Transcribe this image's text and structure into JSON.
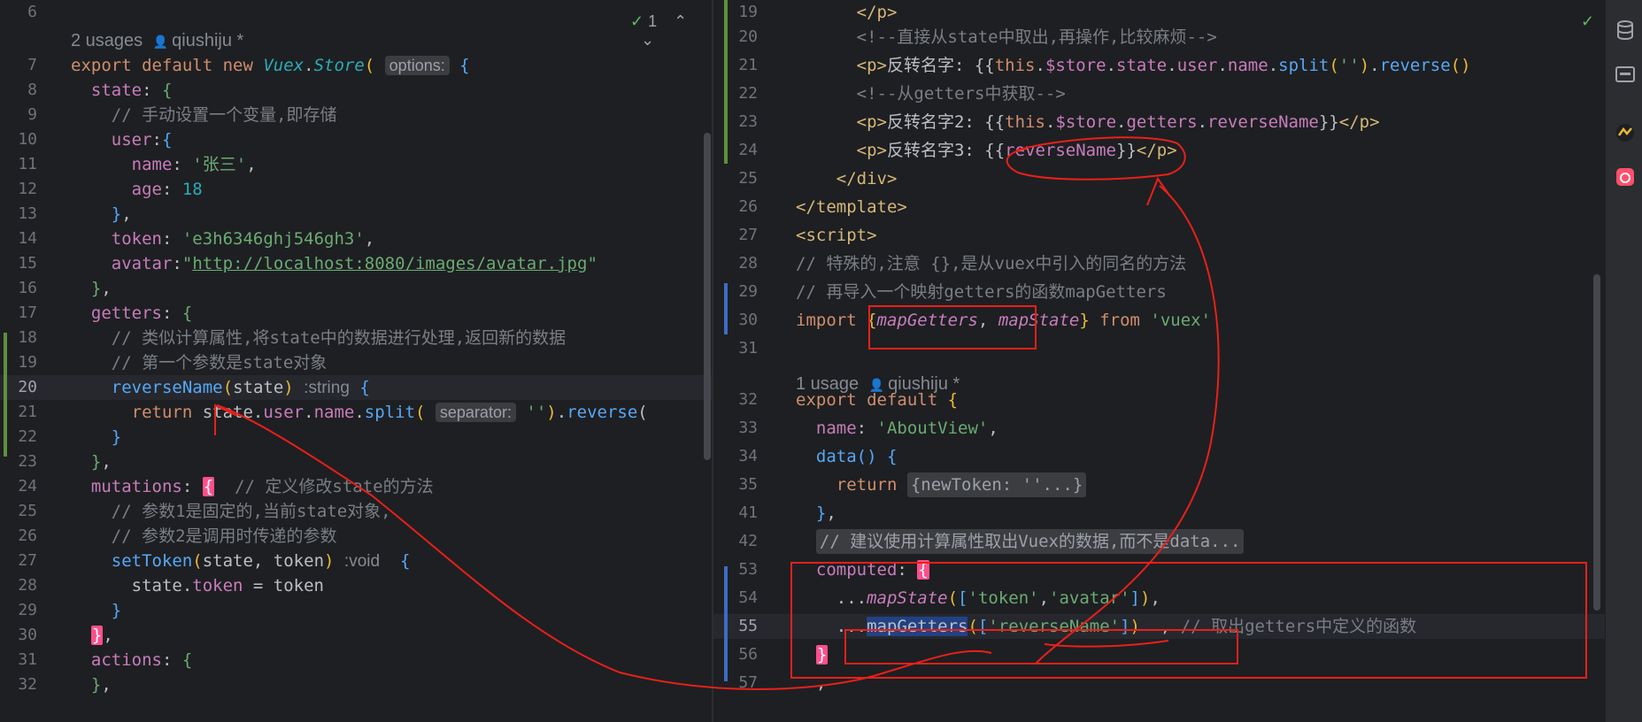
{
  "left_editor": {
    "hint_author": "qiushiju *",
    "hint_usages": "2 usages",
    "inspection_count": "1",
    "lines": [
      {
        "n": "6",
        "segs": []
      },
      {
        "n": "7",
        "segs": [
          [
            "kw",
            "export default new "
          ],
          [
            "cls",
            "Vuex"
          ],
          [
            "plain",
            "."
          ],
          [
            "cls",
            "Store"
          ],
          [
            "brace-y",
            "("
          ],
          [
            "plain",
            " "
          ],
          [
            "inlay",
            "options:"
          ],
          [
            "plain",
            " "
          ],
          [
            "brace-b",
            "{"
          ]
        ]
      },
      {
        "n": "8",
        "segs": [
          [
            "plain",
            "  "
          ],
          [
            "prop",
            "state"
          ],
          [
            "plain",
            ": "
          ],
          [
            "brace-g",
            "{"
          ]
        ]
      },
      {
        "n": "9",
        "segs": [
          [
            "cm",
            "    // 手动设置一个变量,即存储"
          ]
        ]
      },
      {
        "n": "10",
        "segs": [
          [
            "plain",
            "    "
          ],
          [
            "prop",
            "user"
          ],
          [
            "plain",
            ":"
          ],
          [
            "brace-b",
            "{"
          ]
        ]
      },
      {
        "n": "11",
        "segs": [
          [
            "plain",
            "      "
          ],
          [
            "prop",
            "name"
          ],
          [
            "plain",
            ": "
          ],
          [
            "str",
            "'张三'"
          ],
          [
            "plain",
            ","
          ]
        ]
      },
      {
        "n": "12",
        "segs": [
          [
            "plain",
            "      "
          ],
          [
            "prop",
            "age"
          ],
          [
            "plain",
            ": "
          ],
          [
            "num",
            "18"
          ]
        ]
      },
      {
        "n": "13",
        "segs": [
          [
            "plain",
            "    "
          ],
          [
            "brace-b",
            "}"
          ],
          [
            "plain",
            ","
          ]
        ]
      },
      {
        "n": "14",
        "segs": [
          [
            "plain",
            "    "
          ],
          [
            "prop",
            "token"
          ],
          [
            "plain",
            ": "
          ],
          [
            "str",
            "'e3h6346ghj546gh3'"
          ],
          [
            "plain",
            ","
          ]
        ]
      },
      {
        "n": "15",
        "segs": [
          [
            "plain",
            "    "
          ],
          [
            "prop",
            "avatar"
          ],
          [
            "plain",
            ":"
          ],
          [
            "str",
            "\""
          ],
          [
            "url",
            "http://localhost:8080/images/avatar.jpg"
          ],
          [
            "str",
            "\""
          ]
        ]
      },
      {
        "n": "16",
        "segs": [
          [
            "plain",
            "  "
          ],
          [
            "brace-g",
            "}"
          ],
          [
            "plain",
            ","
          ]
        ]
      },
      {
        "n": "17",
        "segs": [
          [
            "plain",
            "  "
          ],
          [
            "prop",
            "getters"
          ],
          [
            "plain",
            ": "
          ],
          [
            "brace-g",
            "{"
          ]
        ]
      },
      {
        "n": "18",
        "segs": [
          [
            "cm",
            "    // 类似计算属性,将state中的数据进行处理,返回新的数据"
          ]
        ]
      },
      {
        "n": "19",
        "segs": [
          [
            "cm",
            "    // 第一个参数是state对象"
          ]
        ]
      },
      {
        "n": "20",
        "segs": [
          [
            "plain",
            "    "
          ],
          [
            "method",
            "reverseName"
          ],
          [
            "brace-y",
            "("
          ],
          [
            "plain",
            "state"
          ],
          [
            "brace-y",
            ")"
          ],
          [
            "plain",
            " "
          ],
          [
            "inlay-type",
            ":string"
          ],
          [
            "plain",
            " "
          ],
          [
            "brace-b",
            "{"
          ]
        ]
      },
      {
        "n": "21",
        "segs": [
          [
            "plain",
            "      "
          ],
          [
            "kw",
            "return "
          ],
          [
            "plain",
            "state."
          ],
          [
            "prop",
            "user"
          ],
          [
            "plain",
            "."
          ],
          [
            "prop",
            "name"
          ],
          [
            "plain",
            "."
          ],
          [
            "method",
            "split"
          ],
          [
            "brace-y",
            "("
          ],
          [
            "plain",
            " "
          ],
          [
            "inlay",
            "separator:"
          ],
          [
            "plain",
            " "
          ],
          [
            "str",
            "''"
          ],
          [
            "brace-y",
            ")"
          ],
          [
            "plain",
            "."
          ],
          [
            "method",
            "reverse"
          ],
          [
            "plain",
            "("
          ]
        ]
      },
      {
        "n": "22",
        "segs": [
          [
            "plain",
            "    "
          ],
          [
            "brace-b",
            "}"
          ]
        ]
      },
      {
        "n": "23",
        "segs": [
          [
            "plain",
            "  "
          ],
          [
            "brace-g",
            "}"
          ],
          [
            "plain",
            ","
          ]
        ]
      },
      {
        "n": "24",
        "segs": [
          [
            "plain",
            "  "
          ],
          [
            "prop",
            "mutations"
          ],
          [
            "plain",
            ": "
          ],
          [
            "pink",
            "{"
          ],
          [
            "cm",
            "  // 定义修改state的方法"
          ]
        ]
      },
      {
        "n": "25",
        "segs": [
          [
            "cm",
            "    // 参数1是固定的,当前state对象,"
          ]
        ]
      },
      {
        "n": "26",
        "segs": [
          [
            "cm",
            "    // 参数2是调用时传递的参数"
          ]
        ]
      },
      {
        "n": "27",
        "segs": [
          [
            "plain",
            "    "
          ],
          [
            "method",
            "setToken"
          ],
          [
            "brace-y",
            "("
          ],
          [
            "plain",
            "state, token"
          ],
          [
            "brace-y",
            ")"
          ],
          [
            "plain",
            " "
          ],
          [
            "inlay-type",
            ":void"
          ],
          [
            "plain",
            "  "
          ],
          [
            "brace-b",
            "{"
          ]
        ]
      },
      {
        "n": "28",
        "segs": [
          [
            "plain",
            "      state."
          ],
          [
            "prop",
            "token"
          ],
          [
            "plain",
            " = token"
          ]
        ]
      },
      {
        "n": "29",
        "segs": [
          [
            "plain",
            "    "
          ],
          [
            "brace-b",
            "}"
          ]
        ]
      },
      {
        "n": "30",
        "segs": [
          [
            "plain",
            "  "
          ],
          [
            "pink",
            "}"
          ],
          [
            "plain",
            ","
          ]
        ]
      },
      {
        "n": "31",
        "segs": [
          [
            "plain",
            "  "
          ],
          [
            "prop",
            "actions"
          ],
          [
            "plain",
            ": "
          ],
          [
            "brace-g",
            "{"
          ]
        ]
      },
      {
        "n": "32",
        "segs": [
          [
            "plain",
            "  "
          ],
          [
            "brace-g",
            "}"
          ],
          [
            "plain",
            ","
          ]
        ]
      }
    ]
  },
  "right_editor": {
    "hint_author": "qiushiju *",
    "hint_usages": "1 usage",
    "lines": [
      {
        "n": "19",
        "segs": [
          [
            "plain",
            "      "
          ],
          [
            "tag",
            "</p>"
          ]
        ]
      },
      {
        "n": "20",
        "segs": [
          [
            "cm",
            "      <!--直接从state中取出,再操作,比较麻烦-->"
          ]
        ]
      },
      {
        "n": "21",
        "segs": [
          [
            "plain",
            "      "
          ],
          [
            "tag",
            "<p>"
          ],
          [
            "plain",
            "反转名字: {{"
          ],
          [
            "kw",
            "this"
          ],
          [
            "plain",
            "."
          ],
          [
            "prop",
            "$store"
          ],
          [
            "plain",
            "."
          ],
          [
            "prop",
            "state"
          ],
          [
            "plain",
            "."
          ],
          [
            "prop",
            "user"
          ],
          [
            "plain",
            "."
          ],
          [
            "prop",
            "name"
          ],
          [
            "plain",
            "."
          ],
          [
            "method",
            "split"
          ],
          [
            "brace-y",
            "("
          ],
          [
            "str",
            "''"
          ],
          [
            "brace-y",
            ")"
          ],
          [
            "plain",
            "."
          ],
          [
            "method",
            "reverse"
          ],
          [
            "brace-y",
            "()"
          ]
        ]
      },
      {
        "n": "22",
        "segs": [
          [
            "cm",
            "      <!--从getters中获取-->"
          ]
        ]
      },
      {
        "n": "23",
        "segs": [
          [
            "plain",
            "      "
          ],
          [
            "tag",
            "<p>"
          ],
          [
            "plain",
            "反转名字2: {{"
          ],
          [
            "kw",
            "this"
          ],
          [
            "plain",
            "."
          ],
          [
            "prop",
            "$store"
          ],
          [
            "plain",
            "."
          ],
          [
            "prop",
            "getters"
          ],
          [
            "plain",
            "."
          ],
          [
            "prop",
            "reverseName"
          ],
          [
            "plain",
            "}}"
          ],
          [
            "tag",
            "</p>"
          ]
        ]
      },
      {
        "n": "24",
        "segs": [
          [
            "plain",
            "      "
          ],
          [
            "tag",
            "<p>"
          ],
          [
            "plain",
            "反转名字3: {{"
          ],
          [
            "prop",
            "reverseName"
          ],
          [
            "plain",
            "}}"
          ],
          [
            "tag",
            "</p>"
          ]
        ]
      },
      {
        "n": "25",
        "segs": [
          [
            "plain",
            "    "
          ],
          [
            "tag",
            "</div>"
          ]
        ]
      },
      {
        "n": "26",
        "segs": [
          [
            "tag",
            "</template>"
          ]
        ]
      },
      {
        "n": "27",
        "segs": [
          [
            "tag",
            "<script>"
          ]
        ]
      },
      {
        "n": "28",
        "segs": [
          [
            "cm",
            "// 特殊的,注意 {},是从vuex中引入的同名的方法"
          ]
        ]
      },
      {
        "n": "29",
        "segs": [
          [
            "cm",
            "// 再导入一个映射getters的函数mapGetters"
          ]
        ]
      },
      {
        "n": "30",
        "segs": [
          [
            "kw",
            "import "
          ],
          [
            "brace-y",
            "{"
          ],
          [
            "mapfn",
            "mapGetters"
          ],
          [
            "plain",
            ", "
          ],
          [
            "mapfn",
            "mapState"
          ],
          [
            "brace-y",
            "}"
          ],
          [
            "kw",
            " from "
          ],
          [
            "str",
            "'vuex'"
          ]
        ]
      },
      {
        "n": "31",
        "segs": []
      },
      {
        "n": "32",
        "segs": [
          [
            "kw",
            "export default "
          ],
          [
            "brace-y",
            "{"
          ]
        ]
      },
      {
        "n": "33",
        "segs": [
          [
            "plain",
            "  "
          ],
          [
            "prop",
            "name"
          ],
          [
            "plain",
            ": "
          ],
          [
            "str",
            "'AboutView'"
          ],
          [
            "plain",
            ","
          ]
        ]
      },
      {
        "n": "34",
        "segs": [
          [
            "plain",
            "  "
          ],
          [
            "method",
            "data"
          ],
          [
            "brace-b",
            "()"
          ],
          [
            "plain",
            " "
          ],
          [
            "brace-b",
            "{"
          ]
        ]
      },
      {
        "n": "35",
        "segs": [
          [
            "plain",
            "    "
          ],
          [
            "kw",
            "return "
          ],
          [
            "fold",
            "{newToken: ''...}"
          ]
        ]
      },
      {
        "n": "41",
        "segs": [
          [
            "plain",
            "  "
          ],
          [
            "brace-b",
            "}"
          ],
          [
            "plain",
            ","
          ]
        ]
      },
      {
        "n": "42",
        "segs": [
          [
            "plain",
            "  "
          ],
          [
            "fold",
            "// 建议使用计算属性取出Vuex的数据,而不是data..."
          ]
        ]
      },
      {
        "n": "53",
        "segs": [
          [
            "plain",
            "  "
          ],
          [
            "prop",
            "computed"
          ],
          [
            "plain",
            ": "
          ],
          [
            "pink",
            "{"
          ]
        ]
      },
      {
        "n": "54",
        "segs": [
          [
            "plain",
            "    ..."
          ],
          [
            "mapfn",
            "mapState"
          ],
          [
            "brace-y",
            "("
          ],
          [
            "brace-b",
            "["
          ],
          [
            "str",
            "'token'"
          ],
          [
            "plain",
            ","
          ],
          [
            "str",
            "'avatar'"
          ],
          [
            "brace-b",
            "]"
          ],
          [
            "brace-y",
            ")"
          ],
          [
            "plain",
            ","
          ]
        ]
      },
      {
        "n": "55",
        "segs": [
          [
            "plain",
            "    ..."
          ],
          [
            "sel",
            "mapGetters"
          ],
          [
            "brace-y",
            "("
          ],
          [
            "brace-b",
            "["
          ],
          [
            "str",
            "'reverseName'"
          ],
          [
            "brace-b",
            "]"
          ],
          [
            "brace-y",
            ")"
          ],
          [
            "plain",
            "  , "
          ],
          [
            "cm",
            "// 取出getters中定义的函数"
          ]
        ]
      },
      {
        "n": "56",
        "segs": [
          [
            "plain",
            "  "
          ],
          [
            "pink",
            "}"
          ]
        ]
      },
      {
        "n": "57",
        "segs": [
          [
            "plain",
            "  ,"
          ]
        ]
      }
    ]
  },
  "tool_strip": [
    "database-icon",
    "terminal-icon",
    "plugin-icon",
    "notification-icon"
  ]
}
